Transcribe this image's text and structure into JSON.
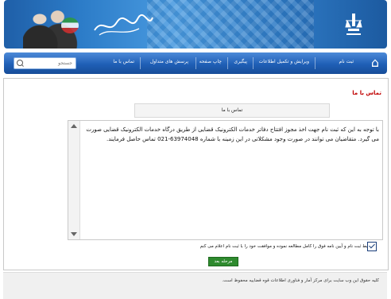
{
  "nav": {
    "items": [
      {
        "label": "ثبت نام"
      },
      {
        "label": "ویرایش و تکمیل اطلاعات"
      },
      {
        "label": "پیگیری"
      },
      {
        "label": "چاپ صفحه"
      },
      {
        "label": "پرسش های متداول"
      },
      {
        "label": "تماس با ما"
      }
    ],
    "search_placeholder": "جستجو"
  },
  "panel": {
    "title": "تماس با ما",
    "tab_label": "تماس با ما",
    "body_text": "با توجه به این که ثبت نام جهت اخذ مجوز افتتاح دفاتر خدمات الکترونیک قضایی از طریق درگاه خدمات الکترونیک قضایی صورت می گیرد. متقاضیان می توانند در صورت وجود مشکلاتی در این زمینه با شماره 63974048-021 تماس حاصل فرمایند."
  },
  "agreement": {
    "label": "شرایط ثبت نام و آیین نامه فوق را کامل مطالعه نموده و موافقت خود را با ثبت نام اعلام می کنم",
    "checked": true
  },
  "next_button": {
    "label": "مرحله بعد"
  },
  "footer": {
    "copyright": "کلیه حقوق این وب سایت برای مرکز آمار و فناوری اطلاعات قوه قضاییه محفوظ است."
  },
  "colors": {
    "accent": "#1f5fb6",
    "title_red": "#c00000",
    "button_green": "#2e8a2e"
  }
}
